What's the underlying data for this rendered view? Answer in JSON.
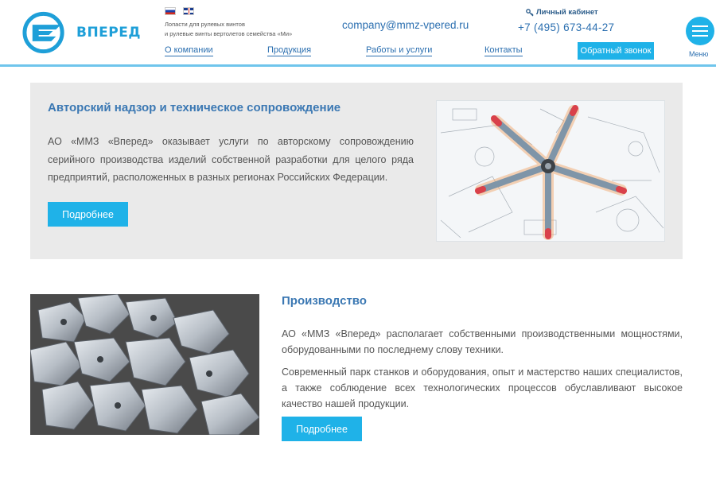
{
  "header": {
    "logo_text": "ВПЕРЕД",
    "tagline_line1": "Лопасти для рулевых винтов",
    "tagline_line2": "и рулевые винты вертолетов семейства «Ми»",
    "email": "company@mmz-vpered.ru",
    "cabinet_label": "Личный кабинет",
    "phone": "+7 (495) 673-44-27",
    "callback_label": "Обратный звонок",
    "menu_label": "Меню",
    "languages": [
      "ru",
      "en"
    ]
  },
  "nav": {
    "items": [
      {
        "label": "О компании"
      },
      {
        "label": "Продукция"
      },
      {
        "label": "Работы и услуги"
      },
      {
        "label": "Контакты"
      }
    ]
  },
  "sections": [
    {
      "title": "Авторский надзор и техническое сопровождение",
      "text": "АО «ММЗ «Вперед» оказывает услуги по авторскому сопровождению серийного производства изделий собственной разработки для целого ряда предприятий, расположенных в разных регионах Российских Федерации.",
      "button": "Подробнее"
    },
    {
      "title": "Производство",
      "p1": "АО «ММЗ «Вперед» располагает собственными производственными мощностями, оборудованными по последнему слову техники.",
      "p2": "Современный парк станков и оборудования, опыт и мастерство наших специалистов, а также соблюдение всех технологических процессов обуславливают высокое качество нашей продукции.",
      "button": "Подробнее"
    }
  ],
  "colors": {
    "accent": "#1fb2e8",
    "link": "#2b6fb0",
    "title": "#3b78b3",
    "panel_bg": "#eaeaea"
  }
}
